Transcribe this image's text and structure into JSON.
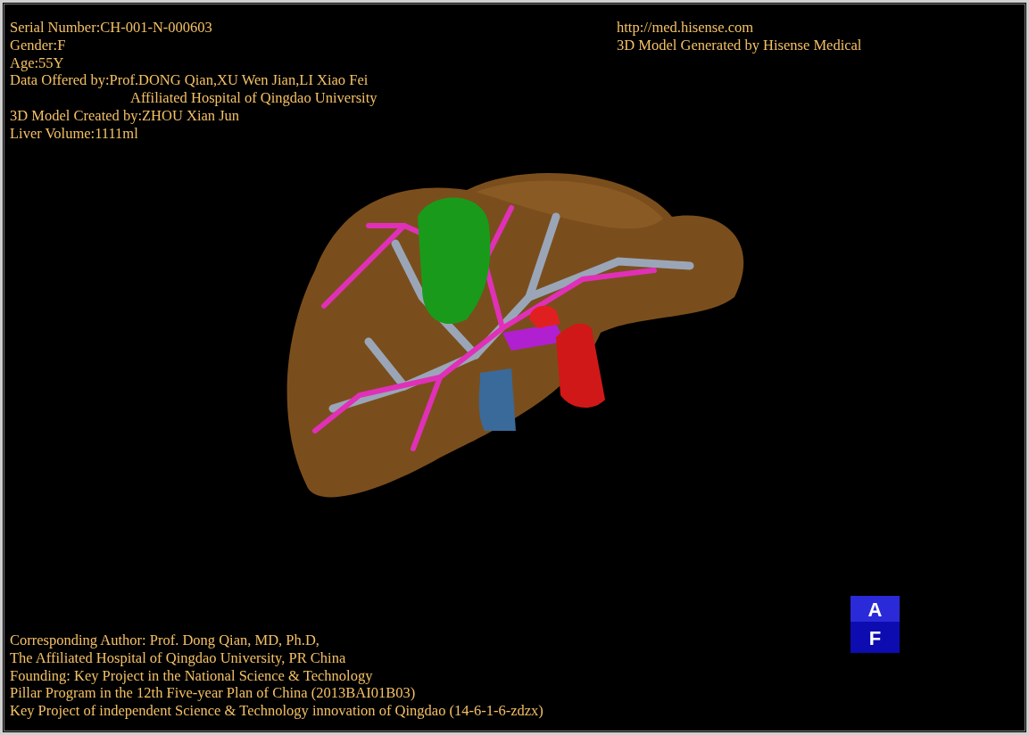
{
  "info_top_left": [
    {
      "text": "Serial Number:CH-001-N-000603",
      "kind": "line"
    },
    {
      "text": "Gender:F",
      "kind": "line"
    },
    {
      "text": "Age:55Y",
      "kind": "line"
    },
    {
      "text": "Data Offered by:Prof.DONG Qian,XU Wen Jian,LI Xiao Fei",
      "kind": "line"
    },
    {
      "text": "Affiliated Hospital of Qingdao University",
      "kind": "continuation"
    },
    {
      "text": "3D Model Created by:ZHOU Xian Jun",
      "kind": "line"
    },
    {
      "text": "Liver Volume:1111ml",
      "kind": "line"
    }
  ],
  "info_top_right": [
    "http://med.hisense.com",
    "3D Model Generated by Hisense Medical"
  ],
  "info_bottom_left": [
    "Corresponding Author: Prof. Dong Qian, MD, Ph.D,",
    "The Affiliated Hospital of Qingdao University, PR China",
    "Founding: Key Project in the National Science & Technology",
    "Pillar Program in the 12th Five-year Plan of China (2013BAI01B03)",
    "Key Project of independent Science & Technology innovation of Qingdao (14-6-1-6-zdzx)"
  ],
  "orientation_cube": {
    "top": "A",
    "front": "F"
  }
}
